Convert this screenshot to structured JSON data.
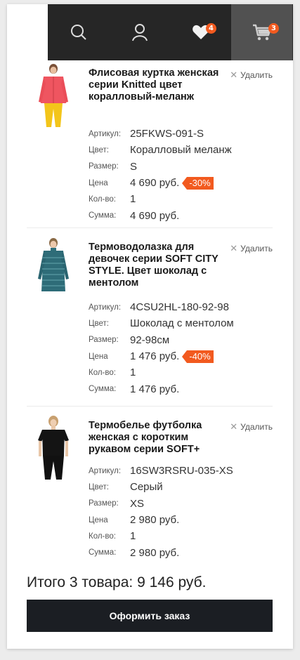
{
  "header": {
    "icons": [
      "search-icon",
      "user-icon",
      "heart-icon",
      "cart-icon"
    ],
    "wishlist_count": "4",
    "cart_count": "3"
  },
  "cart": {
    "remove_label": "Удалить",
    "labels": {
      "sku": "Артикул:",
      "color": "Цвет:",
      "size": "Размер:",
      "price": "Цена",
      "qty": "Кол-во:",
      "sum": "Сумма:"
    },
    "items": [
      {
        "title": "Флисовая куртка женская серии Knitted цвет коралловый-меланж",
        "sku": "25FKWS-091-S",
        "color": "Коралловый меланж",
        "size": "S",
        "price": "4 690 руб.",
        "discount": "-30%",
        "qty": "1",
        "sum": "4 690 руб."
      },
      {
        "title": "Термоводолазка для девочек серии SOFT CITY STYLE. Цвет шоколад с ментолом",
        "sku": "4CSU2HL-180-92-98",
        "color": "Шоколад с ментолом",
        "size": "92-98см",
        "price": "1 476 руб.",
        "discount": "-40%",
        "qty": "1",
        "sum": "1 476 руб."
      },
      {
        "title": "Термобелье футболка женская с коротким рукавом серии SOFT+",
        "sku": "16SW3RSRU-035-XS",
        "color": "Серый",
        "size": "XS",
        "price": "2 980 руб.",
        "discount": "",
        "qty": "1",
        "sum": "2 980 руб."
      }
    ],
    "total": "Итого 3 товара: 9 146 руб.",
    "checkout_label": "Оформить заказ"
  },
  "colors": {
    "header_bg": "#262626",
    "header_active": "#515151",
    "accent": "#f25a1f",
    "button_bg": "#1b1e23"
  }
}
